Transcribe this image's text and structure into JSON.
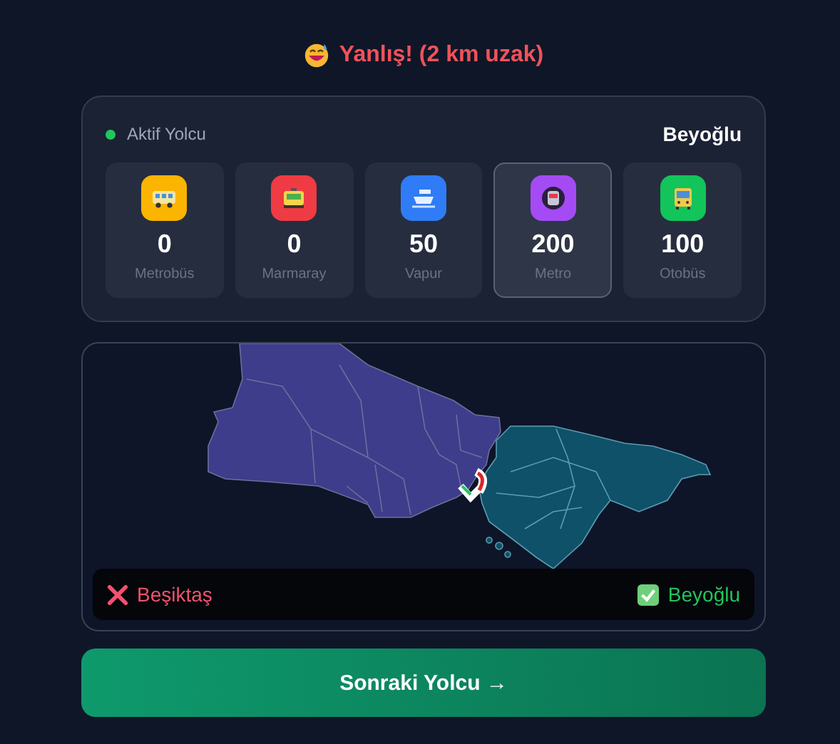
{
  "result": {
    "text": "Yanlış! (2 km uzak)"
  },
  "passenger": {
    "label": "Aktif Yolcu",
    "district": "Beyoğlu"
  },
  "modes": [
    {
      "kind": "bus",
      "value": "0",
      "label": "Metrobüs",
      "color": "#fbb400",
      "selected": false
    },
    {
      "kind": "train",
      "value": "0",
      "label": "Marmaray",
      "color": "#ef3b44",
      "selected": false
    },
    {
      "kind": "ship",
      "value": "50",
      "label": "Vapur",
      "color": "#2f7cf6",
      "selected": false
    },
    {
      "kind": "metro",
      "value": "200",
      "label": "Metro",
      "color": "#a44bf5",
      "selected": true
    },
    {
      "kind": "coach",
      "value": "100",
      "label": "Otobüs",
      "color": "#12c45a",
      "selected": false
    }
  ],
  "map": {
    "answers": [
      {
        "kind": "wrong",
        "text": "Beşiktaş"
      },
      {
        "kind": "correct",
        "text": "Beyoğlu"
      }
    ]
  },
  "next_button": {
    "label": "Sonraki Yolcu →"
  }
}
